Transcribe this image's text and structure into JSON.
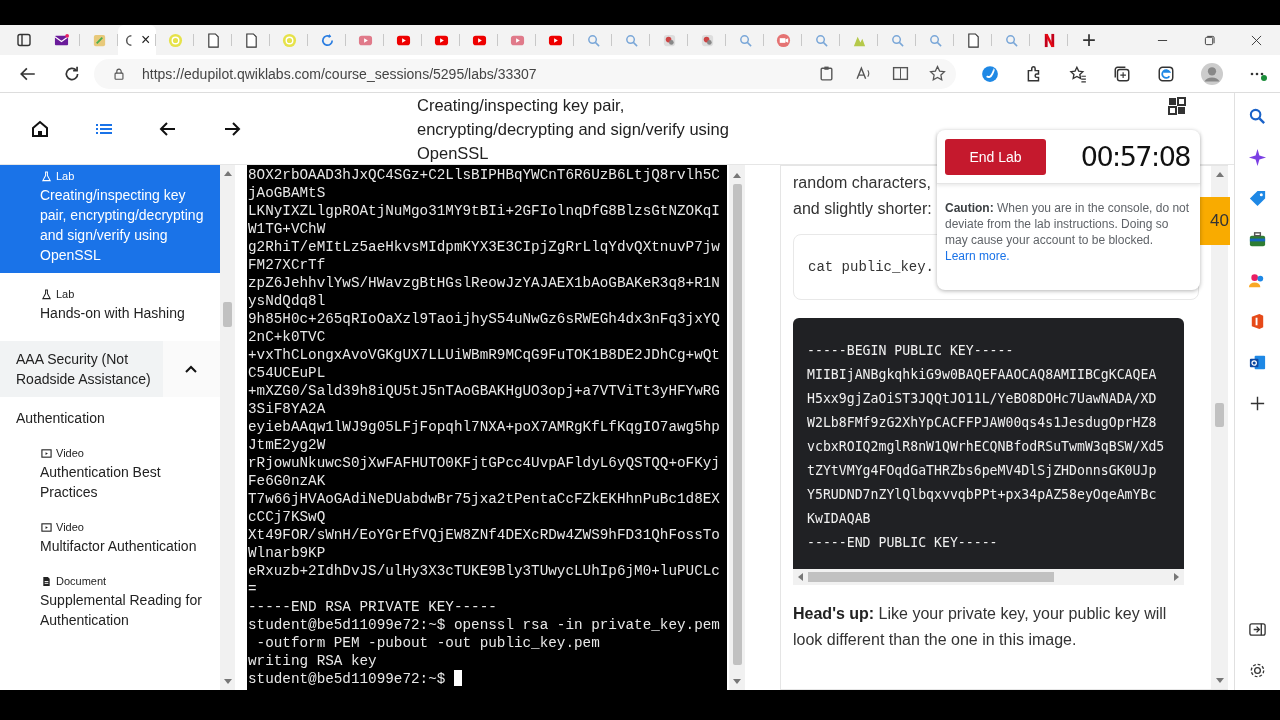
{
  "browser": {
    "tabs": [
      {
        "kind": "mail",
        "selected": false
      },
      {
        "kind": "note",
        "selected": false
      },
      {
        "kind": "partial",
        "selected": true
      },
      {
        "kind": "circle",
        "selected": false
      },
      {
        "kind": "doc",
        "selected": false
      },
      {
        "kind": "doc",
        "selected": false
      },
      {
        "kind": "circle",
        "selected": false
      },
      {
        "kind": "sync",
        "selected": false
      },
      {
        "kind": "video-dim",
        "selected": false
      },
      {
        "kind": "video",
        "selected": false
      },
      {
        "kind": "video",
        "selected": false
      },
      {
        "kind": "video",
        "selected": false
      },
      {
        "kind": "video-dim",
        "selected": false
      },
      {
        "kind": "video",
        "selected": false
      },
      {
        "kind": "search",
        "selected": false
      },
      {
        "kind": "search",
        "selected": false
      },
      {
        "kind": "badge",
        "selected": false
      },
      {
        "kind": "badge",
        "selected": false
      },
      {
        "kind": "search",
        "selected": false
      },
      {
        "kind": "camera",
        "selected": false
      },
      {
        "kind": "search",
        "selected": false
      },
      {
        "kind": "chart",
        "selected": false
      },
      {
        "kind": "search",
        "selected": false
      },
      {
        "kind": "search",
        "selected": false
      },
      {
        "kind": "doc",
        "selected": false
      },
      {
        "kind": "search",
        "selected": false
      },
      {
        "kind": "logo",
        "selected": false
      }
    ],
    "close_glyph": "×",
    "new_tab_glyph": "+",
    "url": "https://edupilot.qwiklabs.com/course_sessions/5295/labs/33307"
  },
  "header": {
    "title": "Creating/inspecting key pair, encrypting/decrypting and sign/verify using OpenSSL"
  },
  "sidebar": [
    {
      "kind": "item",
      "type": "Lab",
      "title": "Creating/inspecting key pair, encrypting/decrypting and sign/verify using OpenSSL",
      "selected": true
    },
    {
      "kind": "item",
      "type": "Lab",
      "title": "Hands-on with Hashing",
      "selected": false
    },
    {
      "kind": "section",
      "title": "AAA Security (Not Roadside Assistance)",
      "expanded": true
    },
    {
      "kind": "subsection",
      "title": "Authentication"
    },
    {
      "kind": "item",
      "type": "Video",
      "title": "Authentication Best Practices",
      "selected": false
    },
    {
      "kind": "item",
      "type": "Video",
      "title": "Multifactor Authentication",
      "selected": false
    },
    {
      "kind": "item",
      "type": "Document",
      "title": "Supplemental Reading for Authentication",
      "selected": false
    }
  ],
  "terminal": {
    "lines": [
      "8OX2rbOAAD3hJxQC4SGz+C2LlsBIPHBqYWCnT6R6UzB6LtjQ8rvlh5C",
      "jAoGBAMtS",
      "LKNyIXZLlgpROAtjNuMgo31MY9tBIi+2GFIolnqDfG8BlzsGtNZOKqI",
      "W1TG+VChW",
      "g2RhiT/eMItLz5aeHkvsMIdpmKYX3E3CIpjZgRrLlqYdvQXtnuvP7jw",
      "FM27XCrTf",
      "zpZ6JehhvlYwS/HWavzgBtHGslReowJzYAJAEX1bAoGBAKeR3q8+R1N",
      "ysNdQdq8l",
      "9h85H0c+265qRIoOaXzl9TaoijhyS54uNwGz6sRWEGh4dx3nFq3jxYQ",
      "2nC+k0TVC",
      "+vxThCLongxAvoVGKgUX7LLUiWBmR9MCqG9FuTOK1B8DE2JDhCg+wQt",
      "C54UCEuPL",
      "+mXZG0/Sald39h8iQU5tJ5nTAoGBAKHgUO3opj+a7VTViTt3yHFYwRG",
      "3SiF8YA2A",
      "eyiebAAqw1lWJ9g05LFjFopqhl7NXA+poX7AMRgKfLfKqgIO7awg5hp",
      "JtmE2yg2W",
      "rRjowuNkuwcS0jXwFAFHUTO0KFjtGPcc4UvpAFldyL6yQSTQQ+oFKyj",
      "Fe6G0nzAK",
      "T7w66jHVAoGAdiNeDUabdwBr75jxa2tPentaCcFZkEKHhnPuBc1d8EX",
      "cCCj7KSwQ",
      "Xt49FOR/sWnH/EoYGrEfVQjEW8ZNf4DEXcRDw4ZWS9hFD31QhFossTo",
      "Wlnarb9KP",
      "eRxuzb+2IdhDvJS/ulHy3X3cTUKE9Bly3TUwycLUhIp6jM0+luPUCLc",
      "=",
      "-----END RSA PRIVATE KEY-----",
      "student@be5d11099e72:~$ openssl rsa -in private_key.pem",
      " -outform PEM -pubout -out public_key.pem",
      "writing RSA key",
      "student@be5d11099e72:~$"
    ]
  },
  "content": {
    "intro_lines": [
      "random characters,",
      "and slightly shorter:"
    ],
    "command": "cat public_key.",
    "key_lines": [
      "-----BEGIN PUBLIC KEY-----",
      "MIIBIjANBgkqhkiG9w0BAQEFAAOCAQ8AMIIBCgKCAQEA",
      "H5xx9gjZaOiST3JQQtJO11L/YeBO8DOHc7UawNADA/XD",
      "W2Lb8FMf9zG2XhYpCACFFPJAW00qs4s1JesdugOprHZ8",
      "vcbxROIQ2mglR8nW1QWrhECQNBfodRSuTwmW3qBSW/Xd5",
      "tZYtVMYg4FOqdGaTHRZbs6peMV4DlSjZHDonnsGK0UJp",
      "Y5RUDND7nZYlQlbqxvvqbPPt+px34pAZ58eyOqeAmYBc",
      "KwIDAQAB",
      "-----END PUBLIC KEY-----"
    ],
    "note": "**Head's up:** Like your private key, your public key will look different than the one in this image."
  },
  "lab_panel": {
    "button": "End Lab",
    "time": "00:57:08",
    "caution": "**Caution:** When you are in the console, do not deviate from the lab instructions. Doing so may cause your account to be blocked.",
    "link": "Learn more.",
    "score": "40"
  }
}
